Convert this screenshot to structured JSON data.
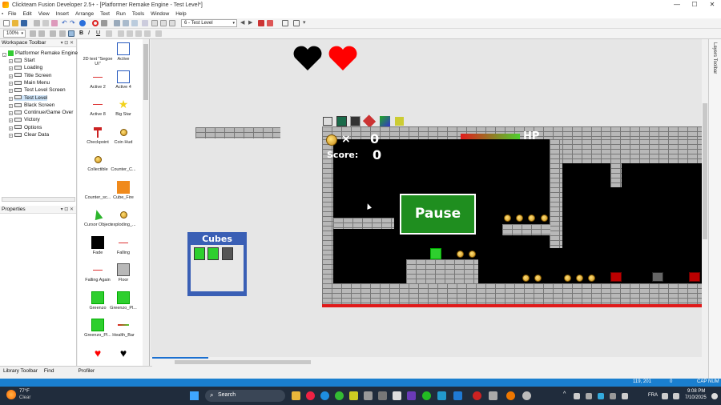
{
  "window": {
    "title": "Clickteam Fusion Developer 2.5+ - [Platformer Remake Engine - Test Level*]",
    "min_glyph": "—",
    "max_glyph": "☐",
    "close_glyph": "✕"
  },
  "menu": [
    "File",
    "Edit",
    "View",
    "Insert",
    "Arrange",
    "Text",
    "Run",
    "Tools",
    "Window",
    "Help"
  ],
  "toolbar": {
    "zoom_value": "100%",
    "frame_select_value": "6 - Test Level",
    "bold": "B",
    "italic": "I",
    "underline": "U"
  },
  "workspace": {
    "title": "Workspace Toolbar",
    "root": "Platformer Remake Engine",
    "frames": [
      "Start",
      "Loading",
      "Title Screen",
      "Main Menu",
      "Test Level Screen",
      "Test Level",
      "Black Screen",
      "Continue/Game Over",
      "Victory",
      "Options",
      "Clear Data"
    ],
    "selected_index": 5
  },
  "properties": {
    "title": "Properties"
  },
  "library_tabs": {
    "library": "Library Toolbar",
    "find": "Find",
    "profiler": "Profiler"
  },
  "objects": [
    {
      "label": "2D text \"Segoe UI\"",
      "icon": "text-icon"
    },
    {
      "label": "Active",
      "icon": "active-icon"
    },
    {
      "label": "Active 2",
      "icon": "line-icon"
    },
    {
      "label": "Active 4",
      "icon": "active-icon"
    },
    {
      "label": "Active 8",
      "icon": "line-icon"
    },
    {
      "label": "Big Star",
      "icon": "star-icon"
    },
    {
      "label": "Checkpoint",
      "icon": "checkpoint-icon"
    },
    {
      "label": "Coin Hud",
      "icon": "coin-icon"
    },
    {
      "label": "Collectible",
      "icon": "coin-icon"
    },
    {
      "label": "Counter_C...",
      "icon": "blank-icon"
    },
    {
      "label": "Counter_sc...",
      "icon": "blank-icon"
    },
    {
      "label": "Cube_Fire",
      "icon": "fire-cube-icon"
    },
    {
      "label": "Cursor Object",
      "icon": "cursor-icon"
    },
    {
      "label": "exploding_...",
      "icon": "coin-icon"
    },
    {
      "label": "Fade",
      "icon": "fade-icon"
    },
    {
      "label": "Falling",
      "icon": "line-icon"
    },
    {
      "label": "Falling Again",
      "icon": "line-icon"
    },
    {
      "label": "Floor",
      "icon": "floor-icon"
    },
    {
      "label": "Greenzo",
      "icon": "greenzo-icon"
    },
    {
      "label": "Greenzo_Pl...",
      "icon": "greenzo-icon"
    },
    {
      "label": "Greenzo_Pl...",
      "icon": "greenzo-icon"
    },
    {
      "label": "Health_Bar",
      "icon": "health-bar-icon"
    },
    {
      "label": "",
      "icon": "heart-red-icon"
    },
    {
      "label": "",
      "icon": "heart-black-icon"
    }
  ],
  "game": {
    "pause_label": "Pause",
    "cubes_label": "Cubes",
    "hud_multiplier": "×",
    "coins_value": "0",
    "score_label": "Score:",
    "score_value": "0",
    "hp_label": "HP",
    "colors": {
      "green_button": "#1f8e1f",
      "frame_bg": "#000000",
      "floor_red": "#e01a1a",
      "cubes_blue": "#3a5fb5"
    }
  },
  "layers_label": "Layers Toolbar",
  "statusbar": {
    "coords": "119, 201",
    "extra": "0",
    "caps": "CAP",
    "num": "NUM"
  },
  "taskbar": {
    "weather_temp": "77°F",
    "weather_desc": "Clear",
    "search_placeholder": "Search",
    "lang": "FRA",
    "time": "9:08 PM",
    "date": "7/10/2025"
  }
}
